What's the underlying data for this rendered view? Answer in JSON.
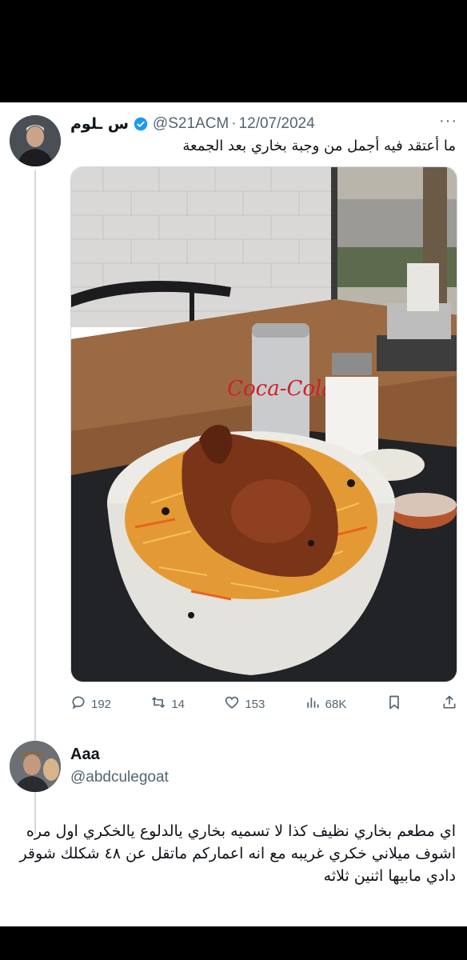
{
  "tweet": {
    "display_name": "س ـلوم",
    "handle": "@S21ACM",
    "separator": "·",
    "date": "12/07/2024",
    "text": "ما أعتقد فيه أجمل من وجبة بخاري بعد الجمعة",
    "media_caption": "Coca-Cola",
    "stats": {
      "replies": "192",
      "retweets": "14",
      "likes": "153",
      "views": "68K"
    }
  },
  "reply": {
    "display_name": "Aaa",
    "handle": "@abdculegoat",
    "text": "اي مطعم بخاري نظيف كذا لا تسميه بخاري يالدلوع يالخكري اول مره اشوف ميلاني خكري غريبه مع انه اعماركم ماتقل عن ٤٨ شكلك شوقر دادي مابيها اثنين ثلاثه"
  },
  "colors": {
    "verified": "#1d9bf0",
    "muted": "#536471",
    "divider": "#cfd9de"
  },
  "icons": [
    "verified-badge-icon",
    "more-icon",
    "reply-icon",
    "retweet-icon",
    "like-icon",
    "views-icon",
    "bookmark-icon",
    "share-icon"
  ]
}
